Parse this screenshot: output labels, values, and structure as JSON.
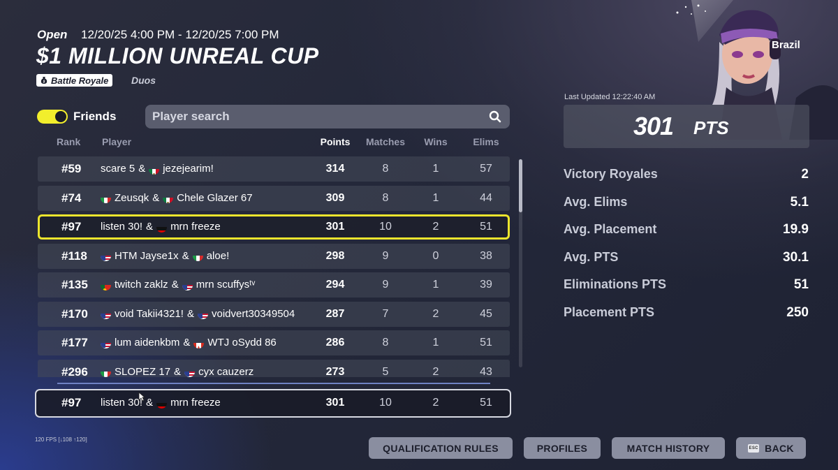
{
  "event": {
    "status": "Open",
    "date_range": "12/20/25 4:00 PM - 12/20/25 7:00 PM",
    "title": "$1 MILLION UNREAL CUP",
    "mode": "Battle Royale",
    "team_type": "Duos"
  },
  "filters": {
    "friends_label": "Friends",
    "friends_on": true,
    "search_placeholder": "Player search"
  },
  "columns": {
    "rank": "Rank",
    "player": "Player",
    "points": "Points",
    "matches": "Matches",
    "wins": "Wins",
    "elims": "Elims"
  },
  "rows": [
    {
      "rank": "#59",
      "p1": "scare 5",
      "f1": "",
      "p2": "jezejearim!",
      "f2": "mexico",
      "points": "314",
      "matches": "8",
      "wins": "1",
      "elims": "57"
    },
    {
      "rank": "#74",
      "p1": "Zeusqk",
      "f1": "italy",
      "p2": "Chele Glazer 67",
      "f2": "mexico",
      "points": "309",
      "matches": "8",
      "wins": "1",
      "elims": "44"
    },
    {
      "rank": "#97",
      "p1": "listen 30!",
      "f1": "",
      "p2": "mrn freeze",
      "f2": "germany",
      "points": "301",
      "matches": "10",
      "wins": "2",
      "elims": "51",
      "highlight": true
    },
    {
      "rank": "#118",
      "p1": "HTM Jayse1x",
      "f1": "usa",
      "p2": "aloe!",
      "f2": "italy",
      "points": "298",
      "matches": "9",
      "wins": "0",
      "elims": "38"
    },
    {
      "rank": "#135",
      "p1": "twitch zaklz",
      "f1": "portugal",
      "p2": "mrn scuffysᵗᵛ",
      "f2": "usa",
      "points": "294",
      "matches": "9",
      "wins": "1",
      "elims": "39"
    },
    {
      "rank": "#170",
      "p1": "void Takii4321!",
      "f1": "usa",
      "p2": "voidvert30349504",
      "f2": "usa",
      "points": "287",
      "matches": "7",
      "wins": "2",
      "elims": "45"
    },
    {
      "rank": "#177",
      "p1": "lum aidenkbm",
      "f1": "usa",
      "p2": "WTJ oSydd 86",
      "f2": "canada",
      "points": "286",
      "matches": "8",
      "wins": "1",
      "elims": "51"
    },
    {
      "rank": "#296",
      "p1": "SLOPEZ 17",
      "f1": "italy",
      "p2": "cyx cauzerz",
      "f2": "usa",
      "points": "273",
      "matches": "5",
      "wins": "2",
      "elims": "43"
    }
  ],
  "pinned": {
    "rank": "#97",
    "p1": "listen 30!",
    "f1": "",
    "p2": "mrn freeze",
    "f2": "germany",
    "points": "301",
    "matches": "10",
    "wins": "2",
    "elims": "51"
  },
  "scroll_position": 0,
  "summary": {
    "country": "Brazil",
    "last_updated": "Last Updated 12:22:40 AM",
    "points": "301",
    "points_unit": "PTS",
    "stats": [
      {
        "label": "Victory Royales",
        "value": "2"
      },
      {
        "label": "Avg. Elims",
        "value": "5.1"
      },
      {
        "label": "Avg. Placement",
        "value": "19.9"
      },
      {
        "label": "Avg. PTS",
        "value": "30.1"
      },
      {
        "label": "Eliminations PTS",
        "value": "51"
      },
      {
        "label": "Placement PTS",
        "value": "250"
      }
    ]
  },
  "buttons": {
    "qualification_rules": "QUALIFICATION RULES",
    "profiles": "PROFILES",
    "match_history": "MATCH HISTORY",
    "esc_key": "ESC",
    "back": "BACK"
  },
  "fps": "120 FPS [↓108 ↑120]",
  "colors": {
    "accent_yellow": "#ece52d",
    "button_gray": "#8a8ea0",
    "divider_blue": "#6f82c4"
  }
}
